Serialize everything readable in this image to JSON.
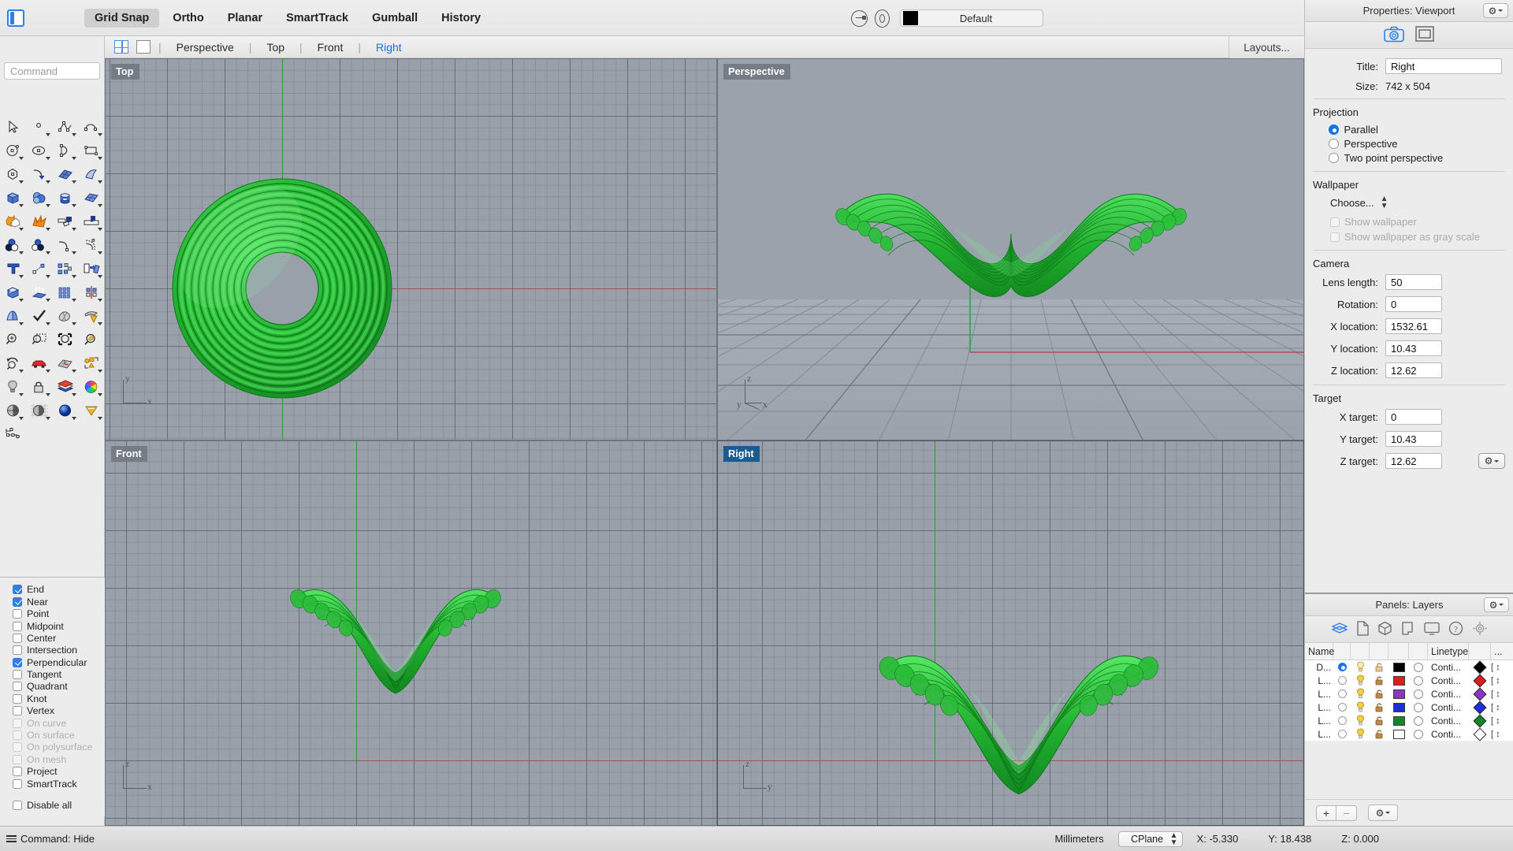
{
  "topbar": {
    "modes": [
      {
        "label": "Grid Snap",
        "active": true
      },
      {
        "label": "Ortho",
        "active": false
      },
      {
        "label": "Planar",
        "active": false
      },
      {
        "label": "SmartTrack",
        "active": false
      },
      {
        "label": "Gumball",
        "active": false
      },
      {
        "label": "History",
        "active": false
      }
    ],
    "layer_swatch_color": "#000000",
    "layer_name": "Default"
  },
  "viewport_tabs": {
    "tabs": [
      {
        "label": "Perspective",
        "active": false
      },
      {
        "label": "Top",
        "active": false
      },
      {
        "label": "Front",
        "active": false
      },
      {
        "label": "Right",
        "active": true
      }
    ],
    "layouts_label": "Layouts..."
  },
  "command": {
    "placeholder": "Command",
    "value": ""
  },
  "osnap": {
    "items": [
      {
        "label": "End",
        "checked": true,
        "disabled": false
      },
      {
        "label": "Near",
        "checked": true,
        "disabled": false
      },
      {
        "label": "Point",
        "checked": false,
        "disabled": false
      },
      {
        "label": "Midpoint",
        "checked": false,
        "disabled": false
      },
      {
        "label": "Center",
        "checked": false,
        "disabled": false
      },
      {
        "label": "Intersection",
        "checked": false,
        "disabled": false
      },
      {
        "label": "Perpendicular",
        "checked": true,
        "disabled": false
      },
      {
        "label": "Tangent",
        "checked": false,
        "disabled": false
      },
      {
        "label": "Quadrant",
        "checked": false,
        "disabled": false
      },
      {
        "label": "Knot",
        "checked": false,
        "disabled": false
      },
      {
        "label": "Vertex",
        "checked": false,
        "disabled": false
      },
      {
        "label": "On curve",
        "checked": false,
        "disabled": true
      },
      {
        "label": "On surface",
        "checked": false,
        "disabled": true
      },
      {
        "label": "On polysurface",
        "checked": false,
        "disabled": true
      },
      {
        "label": "On mesh",
        "checked": false,
        "disabled": true
      },
      {
        "label": "Project",
        "checked": false,
        "disabled": false
      },
      {
        "label": "SmartTrack",
        "checked": false,
        "disabled": false
      }
    ],
    "disable_all": {
      "label": "Disable all",
      "checked": false
    }
  },
  "viewports": [
    {
      "name": "Top",
      "active": false
    },
    {
      "name": "Perspective",
      "active": false
    },
    {
      "name": "Front",
      "active": false
    },
    {
      "name": "Right",
      "active": true
    }
  ],
  "properties": {
    "panel_title": "Properties: Viewport",
    "title_label": "Title:",
    "title_value": "Right",
    "size_label": "Size:",
    "size_value": "742 x 504",
    "projection_title": "Projection",
    "projection_options": [
      {
        "label": "Parallel",
        "selected": true
      },
      {
        "label": "Perspective",
        "selected": false
      },
      {
        "label": "Two point perspective",
        "selected": false
      }
    ],
    "wallpaper_title": "Wallpaper",
    "wallpaper_choose": "Choose...",
    "wallpaper_show": "Show wallpaper",
    "wallpaper_gray": "Show wallpaper as gray scale",
    "camera_title": "Camera",
    "camera_fields": [
      {
        "label": "Lens length:",
        "value": "50"
      },
      {
        "label": "Rotation:",
        "value": "0"
      },
      {
        "label": "X location:",
        "value": "1532.61"
      },
      {
        "label": "Y location:",
        "value": "10.43"
      },
      {
        "label": "Z location:",
        "value": "12.62"
      }
    ],
    "target_title": "Target",
    "target_fields": [
      {
        "label": "X target:",
        "value": "0"
      },
      {
        "label": "Y target:",
        "value": "10.43"
      },
      {
        "label": "Z target:",
        "value": "12.62"
      }
    ]
  },
  "layers": {
    "panel_title": "Panels: Layers",
    "columns": [
      "Name",
      "",
      "",
      "",
      "",
      "",
      "Linetype",
      "",
      "..."
    ],
    "rows": [
      {
        "name": "D...",
        "current": true,
        "color": "#000000",
        "linetype": "Conti...",
        "print_color": "#000000"
      },
      {
        "name": "L...",
        "current": false,
        "color": "#d81f1f",
        "linetype": "Conti...",
        "print_color": "#d81f1f"
      },
      {
        "name": "L...",
        "current": false,
        "color": "#8a36c9",
        "linetype": "Conti...",
        "print_color": "#8a36c9"
      },
      {
        "name": "L...",
        "current": false,
        "color": "#1a2fdb",
        "linetype": "Conti...",
        "print_color": "#1a2fdb"
      },
      {
        "name": "L...",
        "current": false,
        "color": "#14852b",
        "linetype": "Conti...",
        "print_color": "#14852b"
      },
      {
        "name": "L...",
        "current": false,
        "color": "#ffffff",
        "linetype": "Conti...",
        "print_color": "#ffffff"
      }
    ],
    "add_button": "+",
    "remove_button": "−"
  },
  "statusbar": {
    "command_status": "Command: Hide",
    "units": "Millimeters",
    "cplane": "CPlane",
    "x": "X: -5.330",
    "y": "Y: 18.438",
    "z": "Z: 0.000"
  },
  "colors": {
    "accent_blue": "#1473e6",
    "model_green": "#22b02e",
    "viewport_bg": "#98a0aa",
    "axis_red": "#a85055",
    "axis_green": "#2e9b3c"
  }
}
